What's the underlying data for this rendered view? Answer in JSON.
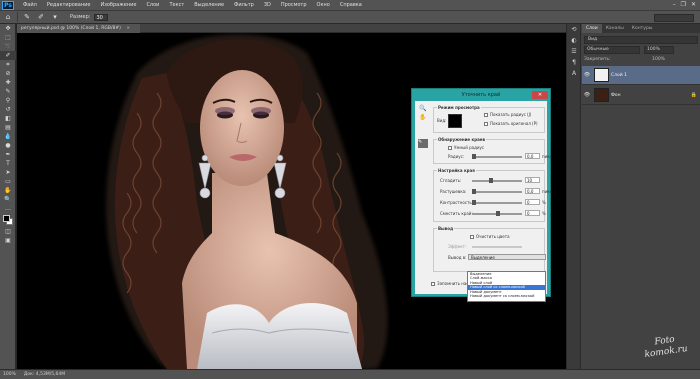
{
  "menubar": {
    "app_icon": "Ps",
    "items": [
      "Файл",
      "Редактирование",
      "Изображение",
      "Слои",
      "Текст",
      "Выделение",
      "Фильтр",
      "3D",
      "Просмотр",
      "Окно",
      "Справка"
    ],
    "window_controls": [
      "minimize-icon",
      "restore-icon",
      "close-icon"
    ]
  },
  "options": {
    "size_label": "Размер:",
    "size_value": "30"
  },
  "document": {
    "tab_title": "регулярный.psd @ 100% (Слой 1, RGB/8#)",
    "close": "×"
  },
  "status": {
    "zoom": "100%",
    "doc_size": "Док: 4,53М/5,64М"
  },
  "layers_panel": {
    "tabs": [
      "Слои",
      "Каналы",
      "Контуры"
    ],
    "active_tab": 0,
    "filter_label": "Вид",
    "blend_mode": "Обычные",
    "opacity": "100%",
    "lock_label": "Закрепить:",
    "fill": "100%",
    "layers": [
      {
        "name": "Слой 1",
        "selected": true
      },
      {
        "name": "Фон",
        "selected": false
      }
    ]
  },
  "refine_edge": {
    "title": "Уточнить край",
    "view_mode": {
      "section_title": "Режим просмотра",
      "view_label": "Вид:",
      "show_radius": "Показать радиус (J)",
      "show_original": "Показать оригинал (P)"
    },
    "edge_detection": {
      "section_title": "Обнаружение краев",
      "smart_radius": "Умный радиус",
      "radius_label": "Радиус:",
      "radius_value": "0,0",
      "radius_unit": "пикс."
    },
    "adjust_edge": {
      "section_title": "Настройка края",
      "rows": [
        {
          "label": "Сгладить:",
          "value": "10",
          "unit": "",
          "fraction": 0.35
        },
        {
          "label": "Растушевка:",
          "value": "0,0",
          "unit": "пикс.",
          "fraction": 0.0
        },
        {
          "label": "Контрастность:",
          "value": "0",
          "unit": "%",
          "fraction": 0.0
        },
        {
          "label": "Сместить край:",
          "value": "0",
          "unit": "%",
          "fraction": 0.5
        }
      ]
    },
    "output": {
      "section_title": "Вывод",
      "decontaminate": "Очистить цвета",
      "amount_label": "Эффект:",
      "output_to_label": "Вывод в:",
      "output_to_value": "Выделение",
      "remember": "Запомнить настройки",
      "dropdown_options": [
        "Выделение",
        "Слой-маска",
        "Новый слой",
        "Новый слой со слоем-маской",
        "Новый документ",
        "Новый документ со слоем-маской"
      ],
      "highlighted_option": 3
    }
  },
  "watermark": {
    "line1": "Foto",
    "line2": "komok.ru"
  },
  "colors": {
    "chrome": "#535353",
    "panel": "#424242",
    "dialog_frame": "#29a3a3",
    "selection": "#596b86",
    "highlight": "#3a74d4"
  }
}
